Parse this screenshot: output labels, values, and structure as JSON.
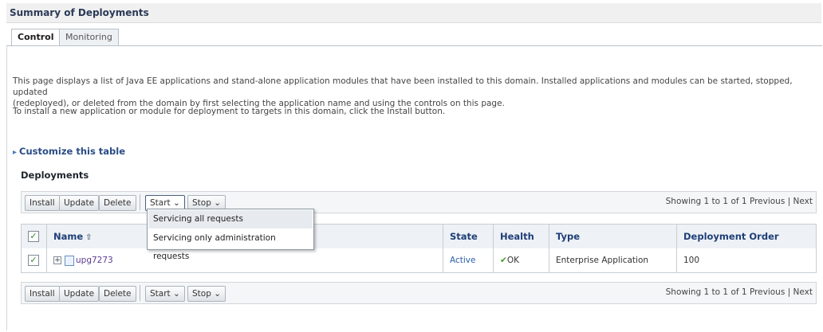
{
  "page": {
    "title": "Summary of Deployments",
    "tabs": [
      "Control",
      "Monitoring"
    ]
  },
  "description": {
    "para1_line1": "This page displays a list of Java EE applications and stand-alone application modules that have been installed to this domain. Installed applications and modules can be started, stopped, updated",
    "para1_line2": "(redeployed), or deleted from the domain by first selecting the application name and using the controls on this page.",
    "para2": "To install a new application or module for deployment to targets in this domain, click the Install button."
  },
  "customize_link": "Customize this table",
  "deployments": {
    "heading": "Deployments",
    "toolbar": {
      "install": "Install",
      "update": "Update",
      "delete": "Delete",
      "start": "Start",
      "stop": "Stop",
      "showing": "Showing 1 to 1 of 1",
      "previous": "Previous",
      "next": "Next"
    },
    "start_menu": [
      "Servicing all requests",
      "Servicing only administration requests"
    ],
    "columns": [
      "Name",
      "State",
      "Health",
      "Type",
      "Deployment Order"
    ],
    "rows": [
      {
        "name": "upg7273",
        "state": "Active",
        "health": "OK",
        "type": "Enterprise Application",
        "order": "100"
      }
    ]
  },
  "colors": {
    "header_link": "#1f3f78",
    "ok": "#3f9a2c",
    "app_link": "#5c3b8f"
  },
  "icons": {
    "sort": "sort-triangle-icon",
    "ok": "check-icon",
    "expand": "plus-box-icon",
    "app": "application-icon",
    "customize": "disclosure-triangle-icon"
  }
}
